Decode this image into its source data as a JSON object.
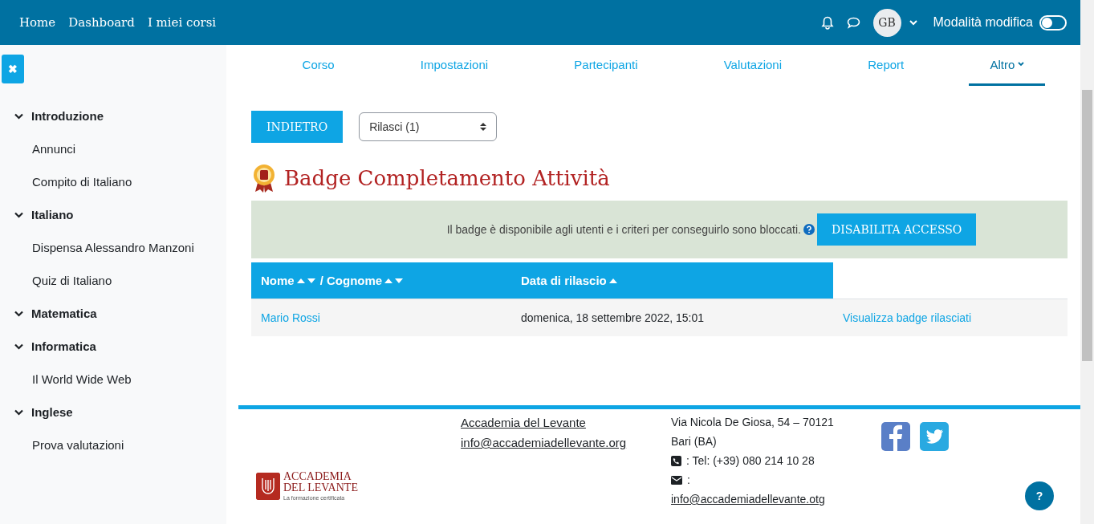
{
  "navbar": {
    "links": [
      "Home",
      "Dashboard",
      "I miei corsi"
    ],
    "avatar": "GB",
    "edit_mode": {
      "label": "Modalità modifica",
      "on": false
    }
  },
  "drawer_toggle": {
    "label": "✖"
  },
  "sidebar": {
    "sections": [
      {
        "label": "Introduzione",
        "expanded": true,
        "children": [
          {
            "label": "Annunci"
          },
          {
            "label": "Compito di Italiano"
          }
        ]
      },
      {
        "label": "Italiano",
        "expanded": true,
        "children": [
          {
            "label": "Dispensa Alessandro Manzoni"
          },
          {
            "label": "Quiz di Italiano"
          }
        ]
      },
      {
        "label": "Matematica",
        "expanded": true
      },
      {
        "label": "Informatica",
        "expanded": true,
        "children": [
          {
            "label": "Il World Wide Web"
          }
        ]
      },
      {
        "label": "Inglese",
        "expanded": true,
        "children": [
          {
            "label": "Prova valutazioni"
          }
        ]
      }
    ]
  },
  "tabs": [
    {
      "label": "Corso",
      "selected": false
    },
    {
      "label": "Impostazioni",
      "selected": false
    },
    {
      "label": "Partecipanti",
      "selected": false
    },
    {
      "label": "Valutazioni",
      "selected": false
    },
    {
      "label": "Report",
      "selected": false
    },
    {
      "label": "Altro",
      "selected": true,
      "dropdown": true
    }
  ],
  "back_button": "INDIETRO",
  "select": {
    "value": "Rilasci (1)"
  },
  "title": "Badge Completamento Attività",
  "alert": {
    "text": "Il badge è disponibile agli utenti e i criteri per conseguirlo sono bloccati.",
    "button": "DISABILITA ACCESSO"
  },
  "table": {
    "columns": [
      "Nome",
      "/ Cognome",
      "Data di rilascio"
    ],
    "rows": [
      {
        "name": "Mario Rossi",
        "date": "domenica, 18 settembre 2022, 15:01",
        "action": "Visualizza badge rilasciati"
      }
    ]
  },
  "footer": {
    "logo": {
      "line_1": "ACCADEMIA",
      "line_2": "DEL LEVANTE",
      "tagline": "La formazione certificata"
    },
    "links": [
      "Accademia del Levante",
      "info@accademiadellevante.org"
    ],
    "address": [
      "Via Nicola De Giosa, 54 – 70121",
      "Bari (BA)"
    ],
    "phone": ": Tel: (+39) 080 214 10 28",
    "email_label": ":",
    "email": "info@accademiadellevante.otg"
  },
  "help_button": "?"
}
